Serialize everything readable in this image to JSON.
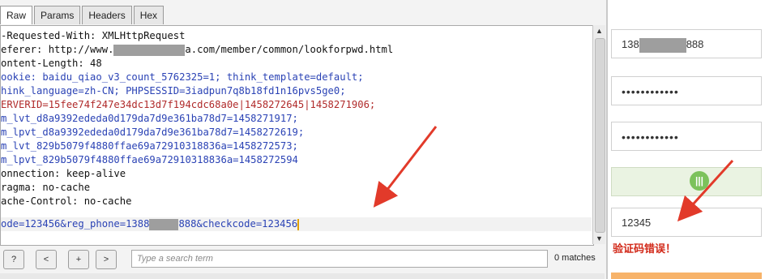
{
  "editor": {
    "tabs": [
      {
        "label": "Raw",
        "active": true
      },
      {
        "label": "Params",
        "active": false
      },
      {
        "label": "Headers",
        "active": false
      },
      {
        "label": "Hex",
        "active": false
      }
    ],
    "lines": [
      {
        "text": "-Requested-With: XMLHttpRequest",
        "color": "black"
      },
      {
        "text": "eferer: http://www.",
        "after": "a.com/member/common/lookforpwd.html",
        "color": "black",
        "masked": true
      },
      {
        "text": "ontent-Length: 48",
        "color": "black"
      },
      {
        "text": "ookie: baidu_qiao_v3_count_5762325=1; think_template=default;",
        "color": "blue"
      },
      {
        "text": "hink_language=zh-CN; PHPSESSID=3iadpun7q8b18fd1n16pvs5ge0;",
        "color": "blue"
      },
      {
        "text": "ERVERID=15fee74f247e34dc13d7f194cdc68a0e|1458272645|1458271906;",
        "color": "red"
      },
      {
        "text": "m_lvt_d8a9392ededa0d179da7d9e361ba78d7=1458271917;",
        "color": "blue"
      },
      {
        "text": "m_lpvt_d8a9392ededa0d179da7d9e361ba78d7=1458272619;",
        "color": "blue"
      },
      {
        "text": "m_lvt_829b5079f4880ffae69a72910318836a=1458272573;",
        "color": "blue"
      },
      {
        "text": "m_lpvt_829b5079f4880ffae69a72910318836a=1458272594",
        "color": "blue"
      },
      {
        "text": "onnection: keep-alive",
        "color": "black"
      },
      {
        "text": "ragma: no-cache",
        "color": "black"
      },
      {
        "text": "ache-Control: no-cache",
        "color": "black"
      }
    ],
    "body_line": {
      "before": "ode=123456&reg_phone=1388",
      "after": "888&checkcode=123456"
    },
    "search": {
      "buttons": [
        "?",
        "<",
        "+",
        ">"
      ],
      "placeholder": "Type a search term",
      "matches": "0 matches"
    }
  },
  "form": {
    "phone_prefix": "138",
    "phone_suffix": "888",
    "password_dots": "••••••••••••",
    "confirm_dots": "••••••••••••",
    "slider_knob": "|||",
    "captcha_value": "12345",
    "error_text": "验证码错误！"
  },
  "colors": {
    "accent_red": "#e23a2a",
    "slider_green": "#7cc25b"
  }
}
